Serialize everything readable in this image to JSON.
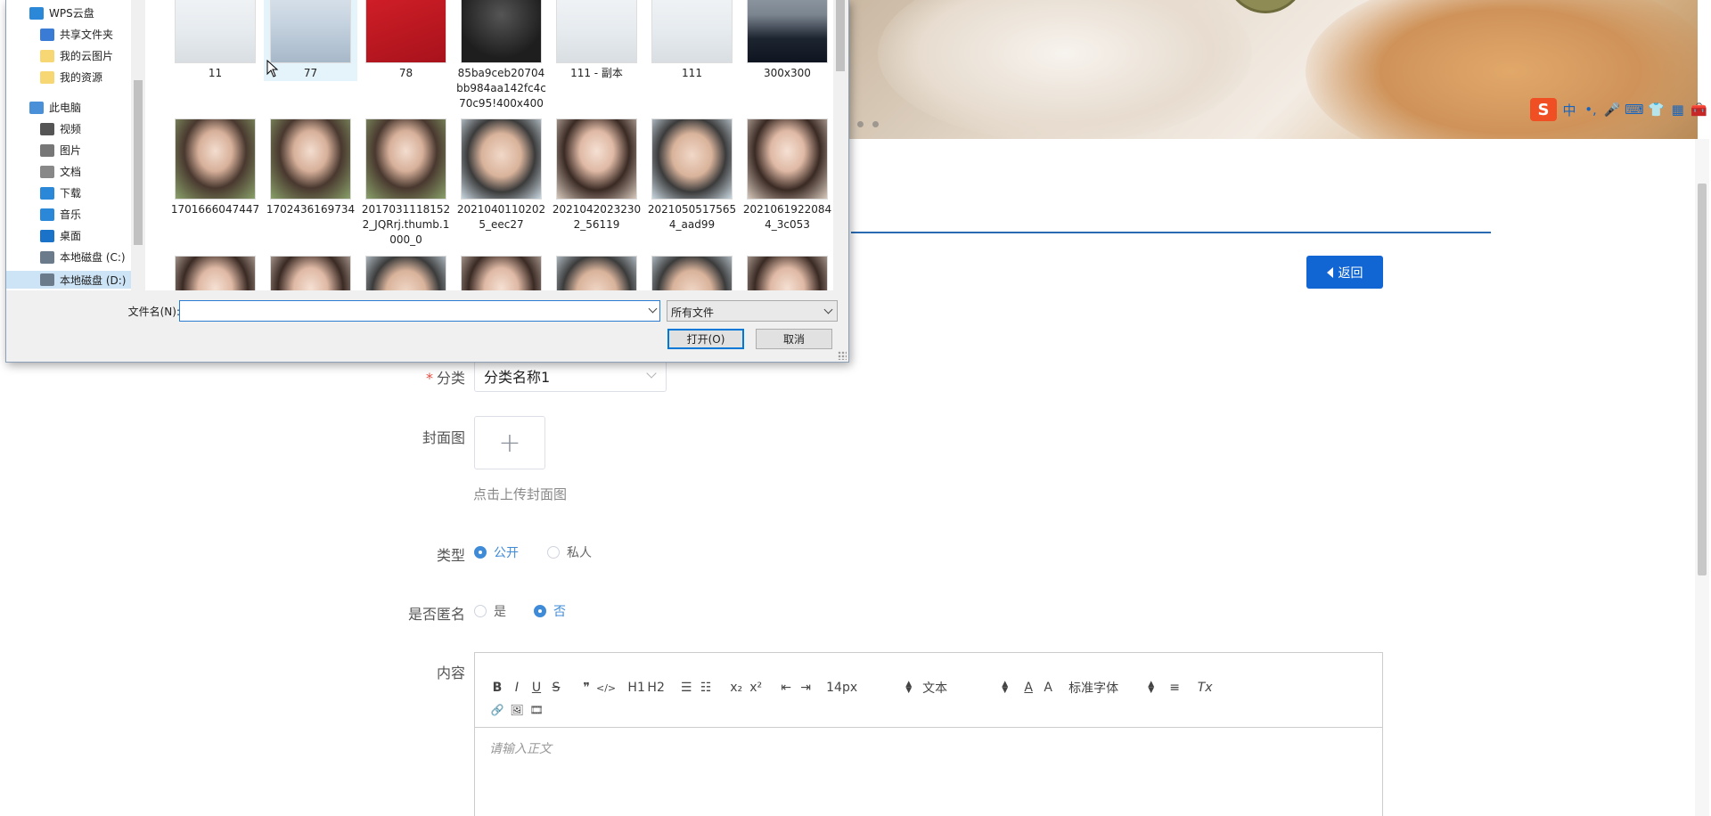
{
  "ime": {
    "logo": "S",
    "items": [
      "中",
      "•,",
      "🎤",
      "⌨",
      "👕",
      "▦",
      "🧰"
    ]
  },
  "header": {
    "back_label": "返回"
  },
  "form": {
    "category": {
      "label": "分类",
      "required_mark": "*",
      "value": "分类名称1"
    },
    "cover": {
      "label": "封面图",
      "plus": "+",
      "tip": "点击上传封面图"
    },
    "type": {
      "label": "类型",
      "options": [
        "公开",
        "私人"
      ],
      "selected": "公开"
    },
    "anonymous": {
      "label": "是否匿名",
      "options": [
        "是",
        "否"
      ],
      "selected": "否"
    },
    "content": {
      "label": "内容",
      "placeholder": "请输入正文",
      "toolbar": {
        "bold": "B",
        "italic": "I",
        "underline": "U",
        "strike": "S",
        "quote": "❞",
        "code": "</>",
        "h1": "H1",
        "h2": "H2",
        "ol": "☰",
        "ul": "☷",
        "sub": "x₂",
        "sup": "x²",
        "outdent": "⇤",
        "indent": "⇥",
        "size": "14px",
        "format": "文本",
        "font": "标准字体",
        "color": "A",
        "bg": "A",
        "align": "≡",
        "clean": "Tx",
        "link": "🔗",
        "image": "🖼",
        "video": "🎞"
      }
    }
  },
  "dialog": {
    "nav": [
      {
        "label": "WPS云盘",
        "icon": "cloud-icon",
        "color": "#2b88d8"
      },
      {
        "label": "共享文件夹",
        "icon": "share-icon",
        "color": "#3a7bd5"
      },
      {
        "label": "我的云图片",
        "icon": "folder-icon",
        "color": "#f7d774"
      },
      {
        "label": "我的资源",
        "icon": "folder-icon",
        "color": "#f7d774"
      },
      {
        "label": "此电脑",
        "icon": "computer-icon",
        "color": "#4a90d9"
      },
      {
        "label": "视频",
        "icon": "video-icon",
        "color": "#555"
      },
      {
        "label": "图片",
        "icon": "picture-icon",
        "color": "#777"
      },
      {
        "label": "文档",
        "icon": "document-icon",
        "color": "#888"
      },
      {
        "label": "下载",
        "icon": "download-icon",
        "color": "#2b88d8"
      },
      {
        "label": "音乐",
        "icon": "music-icon",
        "color": "#2b88d8"
      },
      {
        "label": "桌面",
        "icon": "desktop-icon",
        "color": "#1a73c9"
      },
      {
        "label": "本地磁盘 (C:)",
        "icon": "drive-icon",
        "color": "#6b7b8c"
      },
      {
        "label": "本地磁盘 (D:)",
        "icon": "drive-icon",
        "color": "#6b7b8c"
      }
    ],
    "files": [
      {
        "name": "11",
        "style": "t-doc"
      },
      {
        "name": "77",
        "style": "t-blue"
      },
      {
        "name": "78",
        "style": "t-red"
      },
      {
        "name": "85ba9ceb20704bb984aa142fc4c70c95!400x400",
        "style": "t-dark"
      },
      {
        "name": "111 - 副本",
        "style": "t-doc"
      },
      {
        "name": "111",
        "style": "t-doc"
      },
      {
        "name": "300x300",
        "style": "t-suit"
      },
      {
        "name": "1701666047447",
        "style": "t-face2"
      },
      {
        "name": "1702436169734",
        "style": "t-face2"
      },
      {
        "name": "20170311181522_JQRrj.thumb.1000_0",
        "style": "t-face2"
      },
      {
        "name": "20210401102025_eec27",
        "style": "t-face1"
      },
      {
        "name": "20210420232302_56119",
        "style": "t-face3"
      },
      {
        "name": "20210505175654_aad99",
        "style": "t-face1"
      },
      {
        "name": "20210619220844_3c053",
        "style": "t-face3"
      },
      {
        "name": "",
        "style": "t-face3"
      },
      {
        "name": "",
        "style": "t-face3"
      },
      {
        "name": "",
        "style": "t-face1"
      },
      {
        "name": "",
        "style": "t-face3"
      },
      {
        "name": "",
        "style": "t-face1"
      },
      {
        "name": "",
        "style": "t-face1"
      },
      {
        "name": "",
        "style": "t-face3"
      }
    ],
    "filename_label": "文件名(N):",
    "filename_value": "",
    "filetype": "所有文件",
    "open_label": "打开(O)",
    "cancel_label": "取消"
  }
}
